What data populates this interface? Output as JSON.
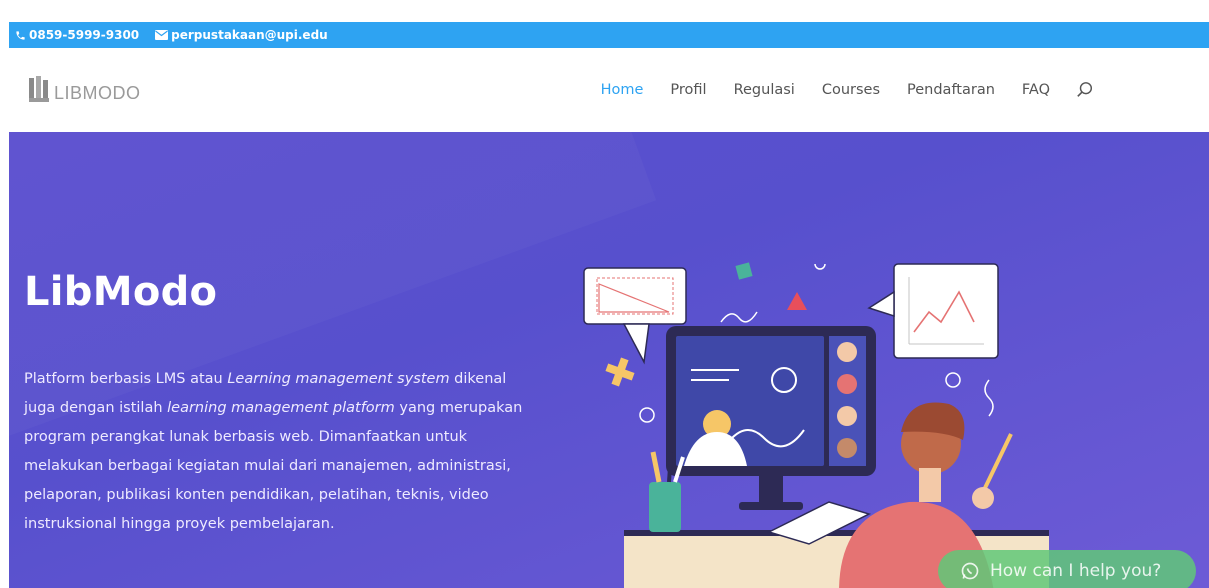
{
  "topbar": {
    "phone": "0859-5999-9300",
    "email": "perpustakaan@upi.edu",
    "background": "#2ea3f2"
  },
  "header": {
    "logo_text": "LIBMODO",
    "nav": {
      "home": "Home",
      "profil": "Profil",
      "regulasi": "Regulasi",
      "courses": "Courses",
      "pendaftaran": "Pendaftaran",
      "faq": "FAQ"
    },
    "active_color": "#2ea3f2"
  },
  "hero": {
    "title": "LibModo",
    "text_1": "Platform berbasis LMS atau ",
    "text_2": "Learning management system",
    "text_3": " dikenal juga dengan istilah ",
    "text_4": "learning management platform",
    "text_5": " yang merupakan program perangkat lunak berbasis web. Dimanfaatkan untuk melakukan berbagai kegiatan mulai dari manajemen, administrasi, pelaporan, publikasi konten pendidikan, pelatihan, teknis, video instruksional hingga proyek pembelajaran.",
    "background": "#5b4fcf"
  },
  "chat": {
    "label": "How can I help you?",
    "color": "#60c878"
  }
}
